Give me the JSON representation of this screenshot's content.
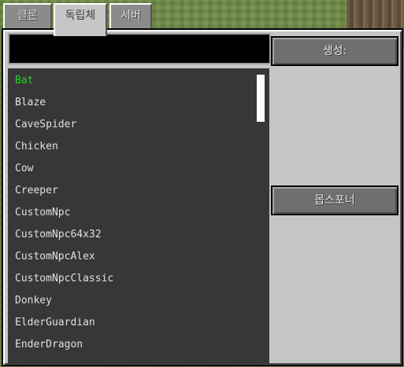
{
  "tabs": [
    {
      "label": "클론",
      "active": false
    },
    {
      "label": "독립체",
      "active": true
    },
    {
      "label": "서버",
      "active": false
    }
  ],
  "search": {
    "value": ""
  },
  "entities": [
    "Bat",
    "Blaze",
    "CaveSpider",
    "Chicken",
    "Cow",
    "Creeper",
    "CustomNpc",
    "CustomNpc64x32",
    "CustomNpcAlex",
    "CustomNpcClassic",
    "Donkey",
    "ElderGuardian",
    "EnderDragon"
  ],
  "selected_entity": "Bat",
  "buttons": {
    "spawn_label": "생성:",
    "spawner_label": "몹스포너"
  },
  "colors": {
    "selected_text": "#22d322",
    "list_bg": "#373737",
    "panel_bg": "#c6c6c6"
  }
}
